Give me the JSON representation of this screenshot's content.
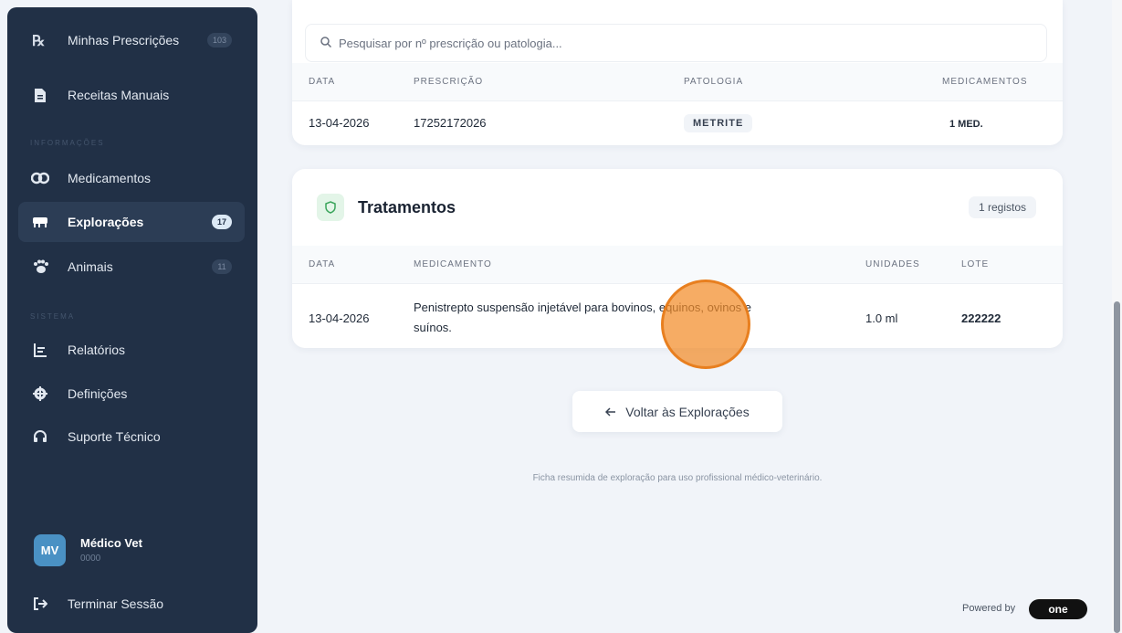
{
  "sidebar": {
    "items_top": [
      {
        "label": "Minhas Prescrições",
        "icon": "rx-icon",
        "badge": "103"
      },
      {
        "label": "Receitas Manuais",
        "icon": "document-icon"
      }
    ],
    "section_info": "INFORMAÇÕES",
    "items_info": [
      {
        "label": "Medicamentos",
        "icon": "pills-icon"
      },
      {
        "label": "Explorações",
        "icon": "cow-icon",
        "badge": "17"
      },
      {
        "label": "Animais",
        "icon": "paw-icon",
        "badge": "11"
      }
    ],
    "section_system": "SISTEMA",
    "items_system": [
      {
        "label": "Relatórios",
        "icon": "chart-icon"
      },
      {
        "label": "Definições",
        "icon": "gear-icon"
      },
      {
        "label": "Suporte Técnico",
        "icon": "headset-icon"
      }
    ],
    "user": {
      "initials": "MV",
      "name": "Médico Vet",
      "id": "0000"
    },
    "logout": "Terminar Sessão"
  },
  "prescriptions": {
    "search_placeholder": "Pesquisar por nº prescrição ou patologia...",
    "headers": [
      "DATA",
      "PRESCRIÇÃO",
      "PATOLOGIA",
      "MEDICAMENTOS"
    ],
    "rows": [
      {
        "date": "13-04-2026",
        "prescription": "17252172026",
        "pathology": "METRITE",
        "medications": "1 MED."
      }
    ]
  },
  "treatments": {
    "title": "Tratamentos",
    "count": "1 registos",
    "headers": [
      "DATA",
      "MEDICAMENTO",
      "UNIDADES",
      "LOTE"
    ],
    "rows": [
      {
        "date": "13-04-2026",
        "medication_line1": "Penistrepto suspensão injetável para bovinos, equinos, ovinos e",
        "medication_line2": "suínos.",
        "units": "1.0 ml",
        "lot": "222222"
      }
    ]
  },
  "back_button": "Voltar às Explorações",
  "footer_note": "Ficha resumida de exploração para uso profissional médico-veterinário.",
  "powered_by": "Powered by",
  "brand": "one",
  "colors": {
    "sidebar": "#213046",
    "accent": "#4a91c4",
    "click_marker": "#f28c28",
    "shield": "#3aa55b"
  }
}
